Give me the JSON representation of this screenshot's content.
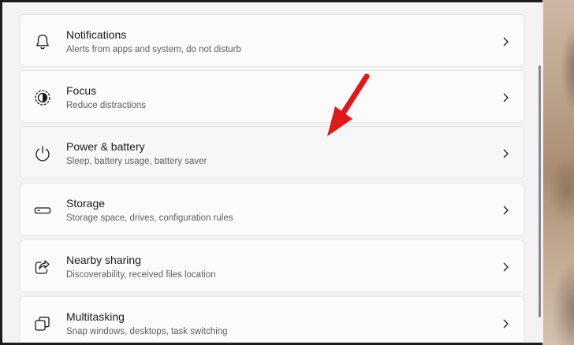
{
  "settings": {
    "items": [
      {
        "title": "Notifications",
        "subtitle": "Alerts from apps and system, do not disturb",
        "icon": "bell-icon"
      },
      {
        "title": "Focus",
        "subtitle": "Reduce distractions",
        "icon": "focus-icon"
      },
      {
        "title": "Power & battery",
        "subtitle": "Sleep, battery usage, battery saver",
        "icon": "power-icon"
      },
      {
        "title": "Storage",
        "subtitle": "Storage space, drives, configuration rules",
        "icon": "storage-icon"
      },
      {
        "title": "Nearby sharing",
        "subtitle": "Discoverability, received files location",
        "icon": "share-icon"
      },
      {
        "title": "Multitasking",
        "subtitle": "Snap windows, desktops, task switching",
        "icon": "multitasking-icon"
      }
    ]
  },
  "annotation": {
    "arrow_color": "#e0181b"
  }
}
